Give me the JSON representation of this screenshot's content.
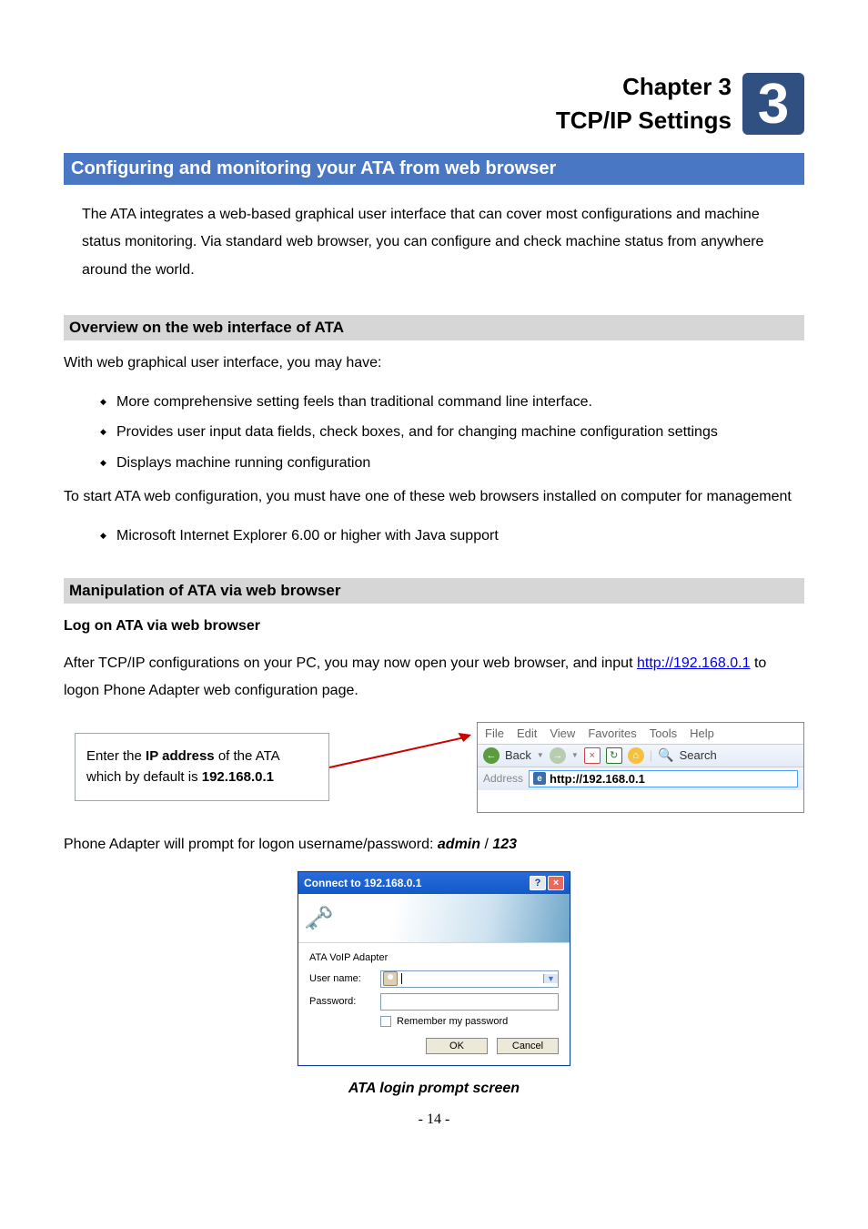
{
  "chapter": {
    "label": "Chapter 3",
    "title": "TCP/IP Settings",
    "badge": "3"
  },
  "h1": "Configuring and monitoring your ATA from web browser",
  "intro": "The ATA integrates a web-based graphical user interface that can cover most configurations and machine status monitoring. Via standard web browser, you can configure and check machine status from anywhere around the world.",
  "h2a": "Overview on the web interface of ATA",
  "overview_intro": "With web graphical user interface, you may have:",
  "overview_bullets": [
    "More comprehensive setting feels than traditional command line interface.",
    "Provides user input data fields, check boxes, and for changing machine configuration settings",
    "Displays machine running configuration"
  ],
  "overview_para2": "To start ATA web configuration, you must have one of these web browsers installed on computer for management",
  "overview_bullets2": [
    "Microsoft Internet Explorer 6.00 or higher with Java support"
  ],
  "h2b": "Manipulation of ATA via web browser",
  "manip_sub": "Log on ATA via web browser",
  "manip_para_pre": "After TCP/IP configurations on your PC, you may now open your web browser, and input ",
  "ip_link": "http://192.168.0.1",
  "manip_para_post": " to logon Phone Adapter web configuration page.",
  "callout_pre": "Enter the ",
  "callout_bold1": "IP address",
  "callout_mid": " of the ATA which by default is ",
  "callout_bold2": "192.168.0.1",
  "browser": {
    "menu": [
      "File",
      "Edit",
      "View",
      "Favorites",
      "Tools",
      "Help"
    ],
    "back": "Back",
    "search": "Search",
    "addr_label": "Address",
    "url": "http://192.168.0.1"
  },
  "prompt_pre": "Phone Adapter will prompt for logon username/password: ",
  "prompt_user": "admin",
  "prompt_sep": " / ",
  "prompt_pass": "123",
  "dialog": {
    "title": "Connect to 192.168.0.1",
    "server_line": "ATA VoIP Adapter",
    "user_label": "User name:",
    "pass_label": "Password:",
    "remember": "Remember my password",
    "ok": "OK",
    "cancel": "Cancel"
  },
  "caption": "ATA login prompt screen",
  "page_number": "- 14 -"
}
